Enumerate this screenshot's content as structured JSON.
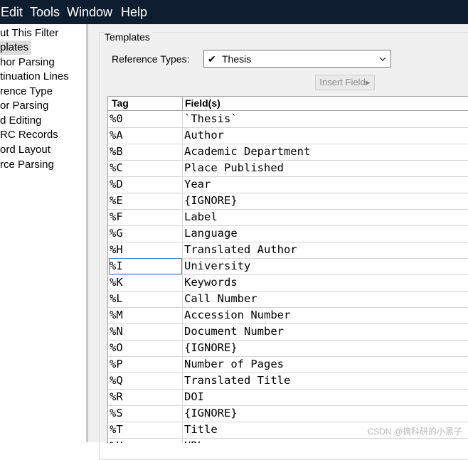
{
  "menubar": {
    "items": [
      "Edit",
      "Tools",
      "Window",
      "Help"
    ]
  },
  "left_pane": {
    "items": [
      {
        "label": "ut This Filter",
        "selected": false
      },
      {
        "label": "plates",
        "selected": true
      },
      {
        "label": "hor Parsing",
        "selected": false
      },
      {
        "label": "tinuation Lines",
        "selected": false
      },
      {
        "label": "rence Type",
        "selected": false
      },
      {
        "label": "or Parsing",
        "selected": false
      },
      {
        "label": "d Editing",
        "selected": false
      },
      {
        "label": "RC Records",
        "selected": false
      },
      {
        "label": "ord Layout",
        "selected": false
      },
      {
        "label": "rce Parsing",
        "selected": false
      }
    ]
  },
  "templates": {
    "group_label": "Templates",
    "reference_types_label": "Reference Types:",
    "reference_type_value": "Thesis",
    "insert_field_label": "Insert Field",
    "columns": [
      "Tag",
      "Field(s)"
    ],
    "rows": [
      {
        "tag": "%0",
        "field": "`Thesis`"
      },
      {
        "tag": "%A",
        "field": "Author"
      },
      {
        "tag": "%B",
        "field": "Academic Department"
      },
      {
        "tag": "%C",
        "field": "Place Published"
      },
      {
        "tag": "%D",
        "field": "Year"
      },
      {
        "tag": "%E",
        "field": "{IGNORE}"
      },
      {
        "tag": "%F",
        "field": "Label"
      },
      {
        "tag": "%G",
        "field": "Language"
      },
      {
        "tag": "%H",
        "field": "Translated Author"
      },
      {
        "tag": "%I",
        "field": "University"
      },
      {
        "tag": "%K",
        "field": "Keywords"
      },
      {
        "tag": "%L",
        "field": "Call Number"
      },
      {
        "tag": "%M",
        "field": "Accession Number"
      },
      {
        "tag": "%N",
        "field": "Document Number"
      },
      {
        "tag": "%O",
        "field": "{IGNORE}"
      },
      {
        "tag": "%P",
        "field": "Number of Pages"
      },
      {
        "tag": "%Q",
        "field": "Translated Title"
      },
      {
        "tag": "%R",
        "field": "DOI"
      },
      {
        "tag": "%S",
        "field": "{IGNORE}"
      },
      {
        "tag": "%T",
        "field": "Title"
      },
      {
        "tag": "%U",
        "field": "URL"
      }
    ],
    "focused_row": 9
  },
  "watermark": "CSDN @搞科研的小黑子"
}
